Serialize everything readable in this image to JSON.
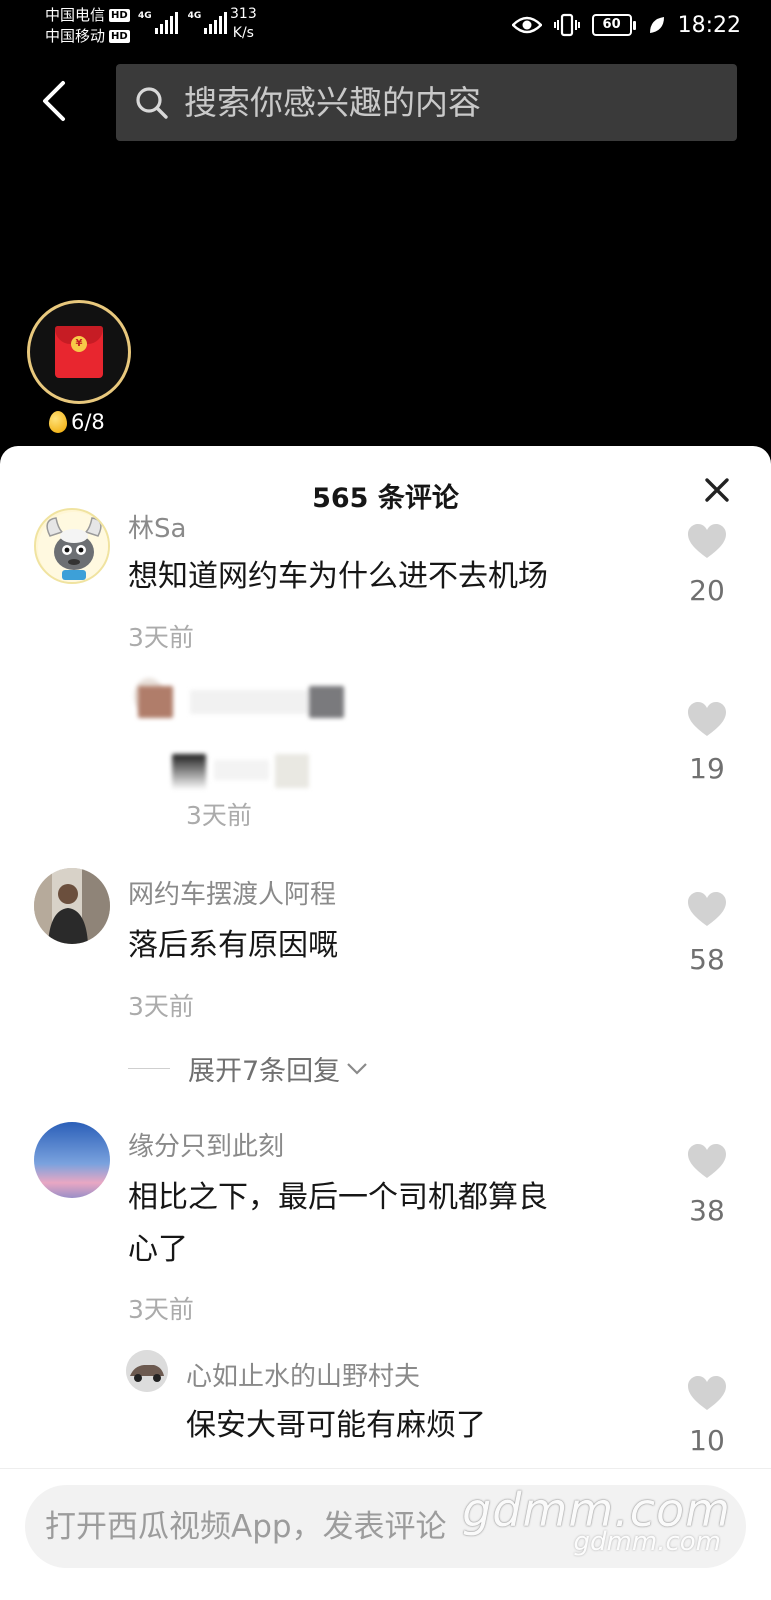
{
  "status_bar": {
    "carrier1": "中国电信",
    "carrier2": "中国移动",
    "hd": "HD",
    "network_type": "4G",
    "speed_value": "313",
    "speed_unit": "K/s",
    "battery": "60",
    "time": "18:22"
  },
  "header": {
    "search_placeholder": "搜索你感兴趣的内容"
  },
  "red_packet": {
    "coin_symbol": "¥",
    "count": "6/8"
  },
  "comments_panel": {
    "title": "565 条评论",
    "comments": [
      {
        "user": "林Sa",
        "text": "想知道网约车为什么进不去机场",
        "time": "3天前",
        "likes": "20"
      },
      {
        "user": "网约车摆渡人阿程",
        "text": "落后系有原因嘅",
        "time": "3天前",
        "likes": "58"
      },
      {
        "user": "缘分只到此刻",
        "text_line1": "相比之下，最后一个司机都算良",
        "text_line2": "心了",
        "time": "3天前",
        "likes": "38"
      }
    ],
    "blurred_reply": {
      "time": "3天前",
      "likes": "19"
    },
    "nested_reply": {
      "user": "心如止水的山野村夫",
      "text": "保安大哥可能有麻烦了",
      "likes": "10"
    },
    "expand_replies": "展开7条回复"
  },
  "bottom": {
    "comment_placeholder": "打开西瓜视频App，发表评论",
    "watermark": "gdmm.com",
    "watermark_sub": "gdmm.com"
  },
  "colors": {
    "panel_bg": "#ffffff",
    "search_bg": "#3a3a3a",
    "ring": "#e8c87d",
    "envelope": "#e8262f"
  }
}
